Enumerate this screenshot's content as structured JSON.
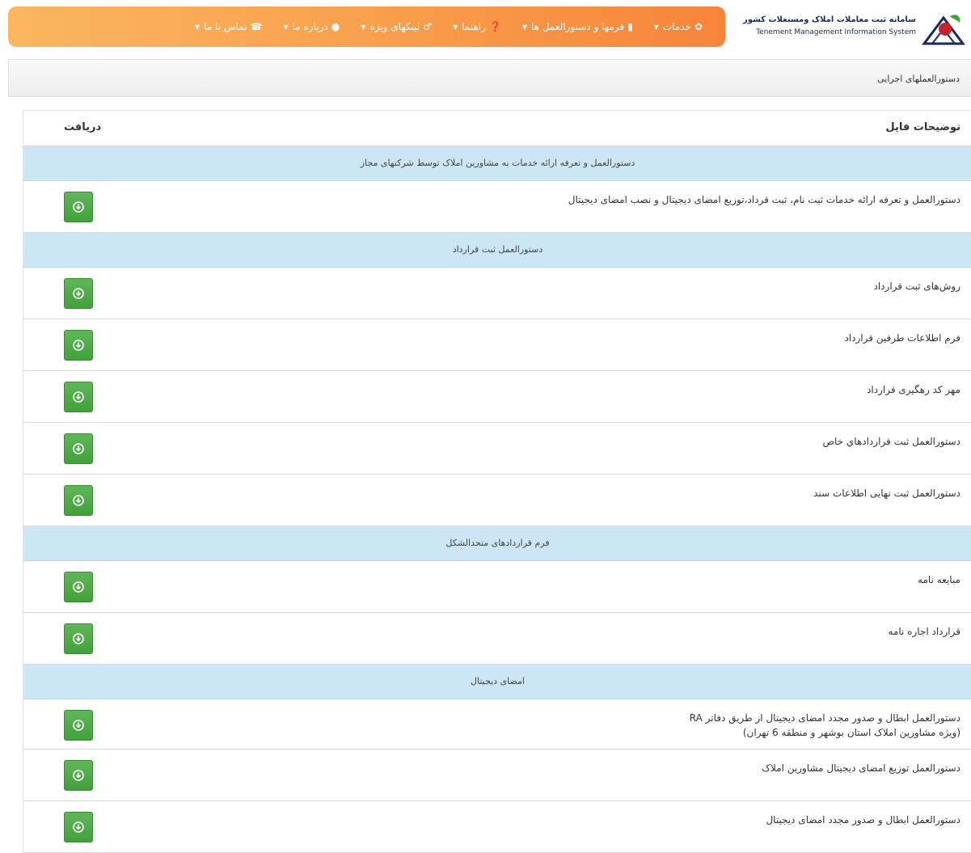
{
  "header": {
    "logo_fa": "سامانه ثبت معاملات املاک ومستغلات کشور",
    "logo_en": "Tenement Management Information System",
    "nav": [
      {
        "label": "خدمات",
        "icon": "gear-icon",
        "glyph": "✿"
      },
      {
        "label": "فرمها و دستورالعمل ها",
        "icon": "file-icon",
        "glyph": "▮"
      },
      {
        "label": "راهنما",
        "icon": "question-icon",
        "glyph": "❓"
      },
      {
        "label": "لینکهای ویژه",
        "icon": "link-icon",
        "glyph": "♂"
      },
      {
        "label": "درباره ما",
        "icon": "user-icon",
        "glyph": "●"
      },
      {
        "label": "تماس با ما",
        "icon": "phone-icon",
        "glyph": "☎"
      }
    ]
  },
  "breadcrumb": "دستورالعملهای اجرایی",
  "table": {
    "col_desc": "توضیحات فایل",
    "col_download": "دریافت"
  },
  "rows": [
    {
      "type": "group",
      "text": "دستورالعمل و تعرفه ارائه خدمات به مشاورین املاک توسط شرکتهای مجاز"
    },
    {
      "type": "item",
      "lines": [
        "دستورالعمل و تعرفه ارائه خدمات ثبت نام، ثبت قرداد،توزیع امضای دیجیتال و نصب امضای دیجیتال"
      ]
    },
    {
      "type": "group",
      "text": "دستورالعمل ثبت قرارداد"
    },
    {
      "type": "item",
      "lines": [
        "روش‌های ثبت قرارداد"
      ]
    },
    {
      "type": "item",
      "lines": [
        "فرم اطلاعات طرفین قرارداد"
      ]
    },
    {
      "type": "item",
      "lines": [
        "مهر کد رهگیری قرارداد"
      ]
    },
    {
      "type": "item",
      "lines": [
        "دستورالعمل ثبت قراردادهاي خاص"
      ]
    },
    {
      "type": "item",
      "lines": [
        "دستورالعمل ثبت نهایی اطلاعات سند"
      ]
    },
    {
      "type": "group",
      "text": "فرم قراردادهای متحدالشکل"
    },
    {
      "type": "item",
      "lines": [
        "مبایعه نامه"
      ]
    },
    {
      "type": "item",
      "lines": [
        "قرارداد اجاره نامه"
      ]
    },
    {
      "type": "group",
      "text": "امضای دیجیتال"
    },
    {
      "type": "item",
      "lines": [
        "دستورالعمل ابطال و صدور مجدد امضای دیجیتال از طریق دفاتر RA",
        "(ویژه مشاورین املاک استان بوشهر و منطقه 6 تهران)"
      ]
    },
    {
      "type": "item",
      "lines": [
        "دستورالعمل توزیع امضای دیجیتال مشاورین املاک"
      ]
    },
    {
      "type": "item",
      "lines": [
        "دستورالعمل ابطال و صدور مجدد امضای دیجیتال"
      ]
    }
  ],
  "colors": {
    "nav_gradient_start": "#fbb660",
    "nav_gradient_end": "#f7843a",
    "group_bg": "#cde6f6",
    "button_green": "#4caf43"
  }
}
